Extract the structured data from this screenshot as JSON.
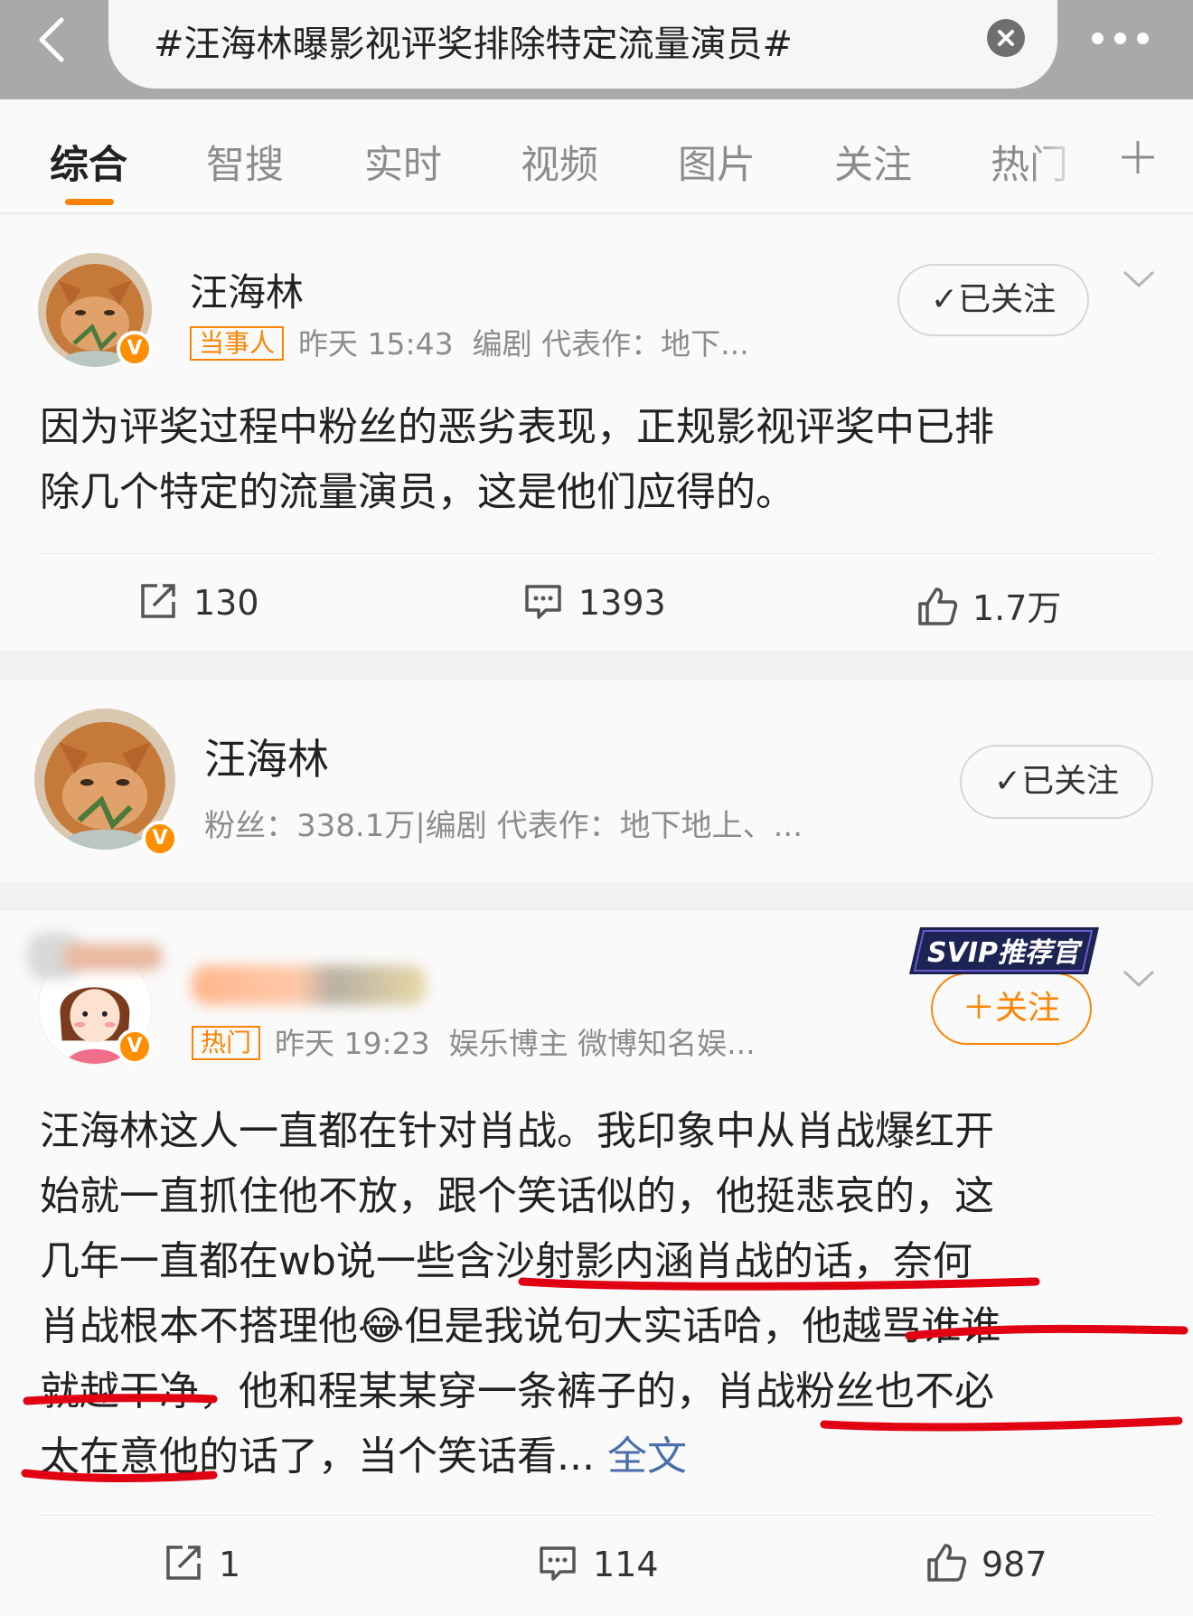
{
  "search": {
    "query": "#汪海林曝影视评奖排除特定流量演员#"
  },
  "tabs": [
    "综合",
    "智搜",
    "实时",
    "视频",
    "图片",
    "关注",
    "热门"
  ],
  "posts": [
    {
      "username": "汪海林",
      "tag": "当事人",
      "time": "昨天 15:43",
      "desc": "编剧  代表作：地下...",
      "follow_label": "✓已关注",
      "lines": [
        "因为评奖过程中粉丝的恶劣表现，正规影视评奖中已排",
        "除几个特定的流量演员，这是他们应得的。"
      ],
      "reposts": "130",
      "comments": "1393",
      "likes": "1.7万"
    },
    {
      "username": "",
      "tag": "热门",
      "time": "昨天 19:23",
      "desc": "娱乐博主 微博知名娱...",
      "follow_label": "＋关注",
      "svip_label": "SVIP推荐官",
      "lines": [
        "汪海林这人一直都在针对肖战。我印象中从肖战爆红开",
        "始就一直抓住他不放，跟个笑话似的，他挺悲哀的，这",
        "几年一直都在wb说一些含沙射影内涵肖战的话，奈何",
        "肖战根本不搭理他😂但是我说句大实话哈，他越骂谁谁",
        "就越干净，他和程某某穿一条裤子的，肖战粉丝也不必",
        "太在意他的话了，当个笑话看..."
      ],
      "more_link": "全文",
      "reposts": "1",
      "comments": "114",
      "likes": "987"
    }
  ],
  "user_card": {
    "username": "汪海林",
    "info": "粉丝：338.1万|编剧  代表作：地下地上、...",
    "follow_label": "✓已关注"
  },
  "colors": {
    "accent": "#ff8200",
    "link": "#4a6ea9",
    "annotation": "#e00012"
  },
  "icons": [
    "back-arrow-icon",
    "clear-icon",
    "more-icon",
    "plus-icon",
    "verified-icon",
    "chevron-down-icon",
    "repost-icon",
    "comment-icon",
    "like-icon"
  ]
}
